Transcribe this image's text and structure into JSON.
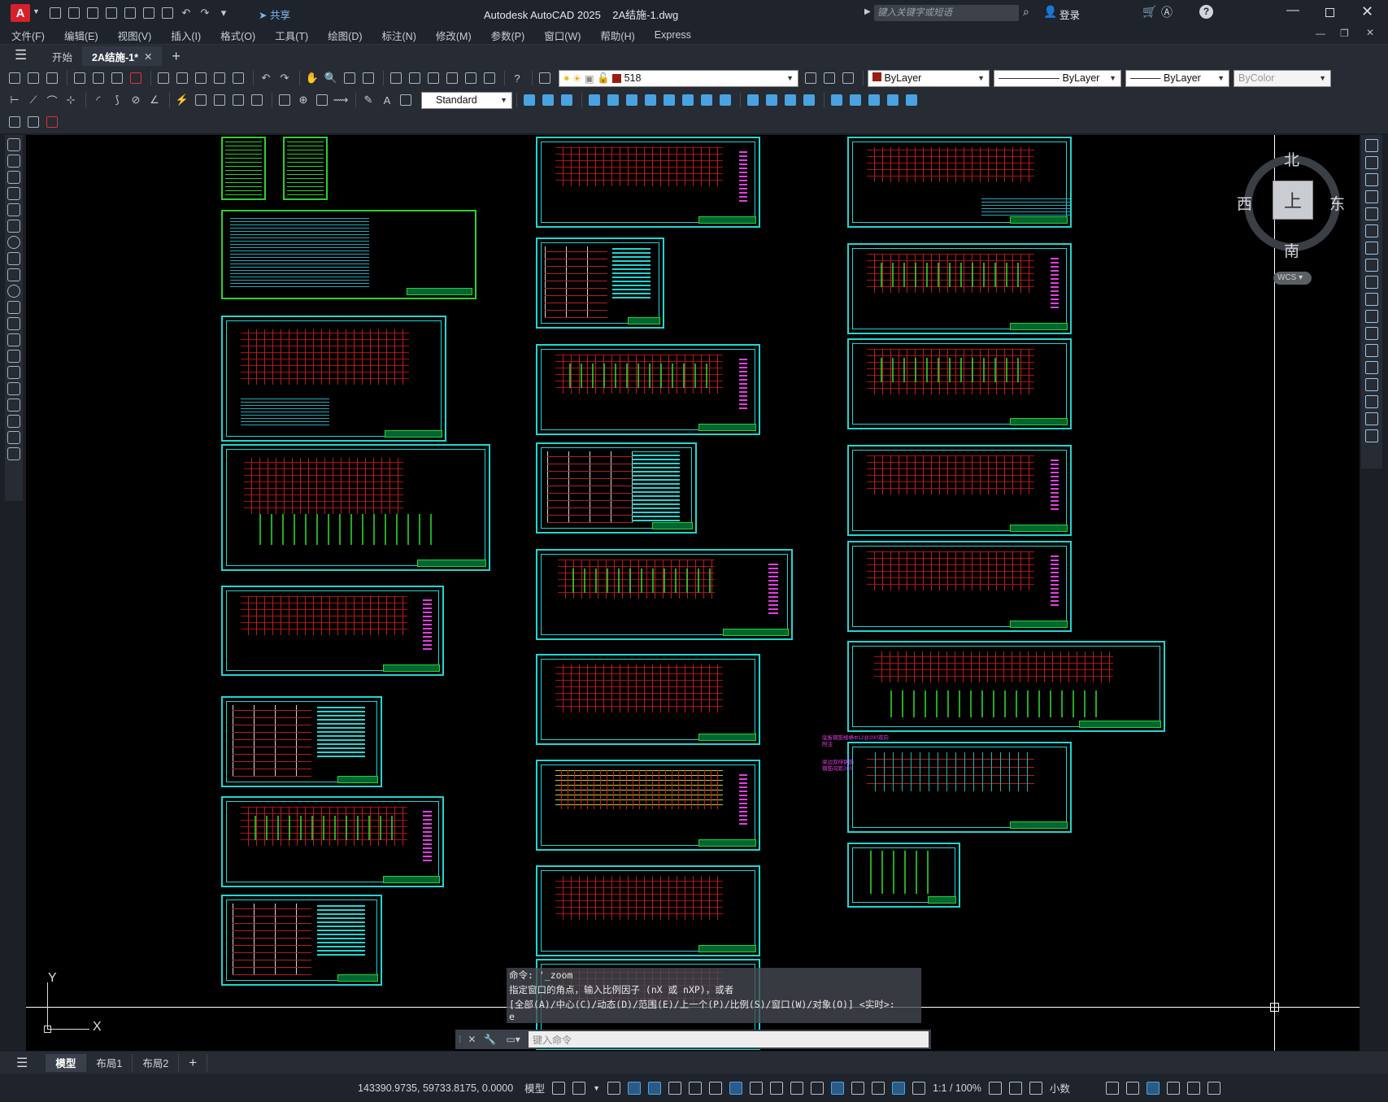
{
  "app": {
    "logo_letter": "A",
    "share_label": "共享",
    "title": "Autodesk AutoCAD 2025",
    "filename": "2A结施-1.dwg",
    "search_placeholder": "键入关键字或短语",
    "login_label": "登录"
  },
  "menu": [
    "文件(F)",
    "编辑(E)",
    "视图(V)",
    "插入(I)",
    "格式(O)",
    "工具(T)",
    "绘图(D)",
    "标注(N)",
    "修改(M)",
    "参数(P)",
    "窗口(W)",
    "帮助(H)",
    "Express"
  ],
  "file_tabs": {
    "start": "开始",
    "active": "2A结施-1*"
  },
  "layer": {
    "current": "518",
    "color": "#9b1c10"
  },
  "properties": {
    "color": "ByLayer",
    "linetype": "ByLayer",
    "lineweight": "ByLayer",
    "plotstyle": "ByColor"
  },
  "textstyle": "Standard",
  "viewcube": {
    "north": "北",
    "south": "南",
    "east": "东",
    "west": "西",
    "top": "上",
    "wcs": "WCS"
  },
  "ucs": {
    "x": "X",
    "y": "Y"
  },
  "annotation": {
    "line1": "底板钢筋规格Φ12@200双向",
    "line2": "梁边双排钢筋",
    "line3": "钢筋间距200",
    "line4": "附注"
  },
  "command": {
    "history": [
      "命令: '_zoom",
      "指定窗口的角点，输入比例因子 (nX 或 nXP)，或者",
      "[全部(A)/中心(C)/动态(D)/范围(E)/上一个(P)/比例(S)/窗口(W)/对象(O)] <实时>:",
      "e"
    ],
    "placeholder": "键入命令"
  },
  "layout_tabs": [
    "模型",
    "布局1",
    "布局2"
  ],
  "status": {
    "coords": "143390.9735, 59733.8175, 0.0000",
    "space": "模型",
    "scale": "1:1 / 100%",
    "units": "小数"
  },
  "colors": {
    "canvas": "#000000",
    "sheet_border": "#1fd7d3",
    "accent": "#4aa3e0"
  }
}
